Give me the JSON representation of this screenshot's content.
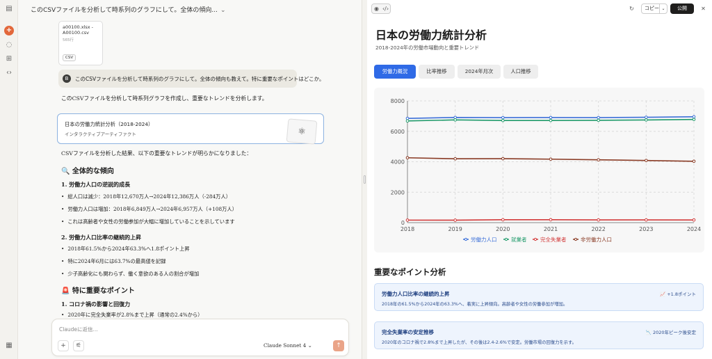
{
  "chat": {
    "title": "このCSVファイルを分析して時系列のグラフにして。全体の傾向...",
    "file": {
      "name": "a00100.xlsx - A00100.csv",
      "size": "565行",
      "type": "CSV"
    },
    "user_avatar": "B",
    "user_message": "このCSVファイルを分析して時系列のグラフにして。全体の傾向も教えて。特に重要なポイントはどこか。",
    "reply_intro": "このCSVファイルを分析して時系列グラフを作成し、重要なトレンドを分析します。",
    "artifact": {
      "title": "日本の労働力統計分析（2018-2024）",
      "subtitle": "インタラクティブアーティファクト"
    },
    "analysis_intro": "CSVファイルを分析した結果、以下の重要なトレンドが明らかになりました：",
    "section1": "🔍 全体的な傾向",
    "sub1": "1. 労働力人口の逆説的成長",
    "sub1_bullets": [
      "総人口は減少：2018年12,670万人→2024年12,386万人（-284万人）",
      "労働力人口は増加：2018年6,849万人→2024年6,957万人（+108万人）",
      "これは高齢者や女性の労働参加が大幅に増加していることを示しています"
    ],
    "sub2": "2. 労働力人口比率の継続的上昇",
    "sub2_bullets": [
      "2018年61.5%から2024年63.3%へ1.8ポイント上昇",
      "特に2024年6月には63.7%の最高値を記録",
      "少子高齢化にも関わらず、働く意欲のある人の割合が増加"
    ],
    "section2": "🚨 特に重要なポイント",
    "sub3": "1. コロナ禍の影響と回復力",
    "sub3_bullets": [
      "2020年に完全失業率が2.8%まで上昇（通常の2.4%から）"
    ],
    "composer_placeholder": "Claudeに返信...",
    "model": "Claude Sonnet 4"
  },
  "panel": {
    "copy_label": "コピー",
    "publish_label": "公開",
    "title": "日本の労働力統計分析",
    "subtitle": "2018-2024年の労働市場動向と重要トレンド",
    "tabs": [
      "労働力概況",
      "比率推移",
      "2024年月次",
      "人口推移"
    ],
    "key_points_title": "重要なポイント分析",
    "cards": [
      {
        "title": "労働力人口比率の継続的上昇",
        "desc": "2018年の61.5%から2024年の63.3%へ、着実に上昇傾向。高齢者や女性の労働参加が増加。",
        "badge": "📈 +1.8ポイント"
      },
      {
        "title": "完全失業率の安定推移",
        "desc": "2020年のコロナ禍で2.8%まで上昇したが、その後は2.4-2.6%で安定。労働市場の回復力を示す。",
        "badge": "📉 2020年ピーク後安定"
      }
    ]
  },
  "chart_data": {
    "type": "line",
    "x": [
      2018,
      2019,
      2020,
      2021,
      2022,
      2023,
      2024
    ],
    "ylim": [
      0,
      8000
    ],
    "yticks": [
      0,
      2000,
      4000,
      6000,
      8000
    ],
    "series": [
      {
        "name": "労働力人口",
        "color": "#3b6fd8",
        "values": [
          6849,
          6912,
          6902,
          6907,
          6902,
          6925,
          6957
        ]
      },
      {
        "name": "就業者",
        "color": "#1f9a6a",
        "values": [
          6682,
          6750,
          6710,
          6713,
          6723,
          6747,
          6781
        ]
      },
      {
        "name": "完全失業者",
        "color": "#d23a3a",
        "values": [
          166,
          162,
          191,
          193,
          179,
          178,
          176
        ]
      },
      {
        "name": "非労働力人口",
        "color": "#8a3b25",
        "values": [
          4263,
          4197,
          4204,
          4171,
          4128,
          4084,
          4032
        ]
      }
    ],
    "legend": "bottom"
  },
  "colors": {
    "accent": "#2f6ae6",
    "claude_orange": "#e2673a"
  }
}
